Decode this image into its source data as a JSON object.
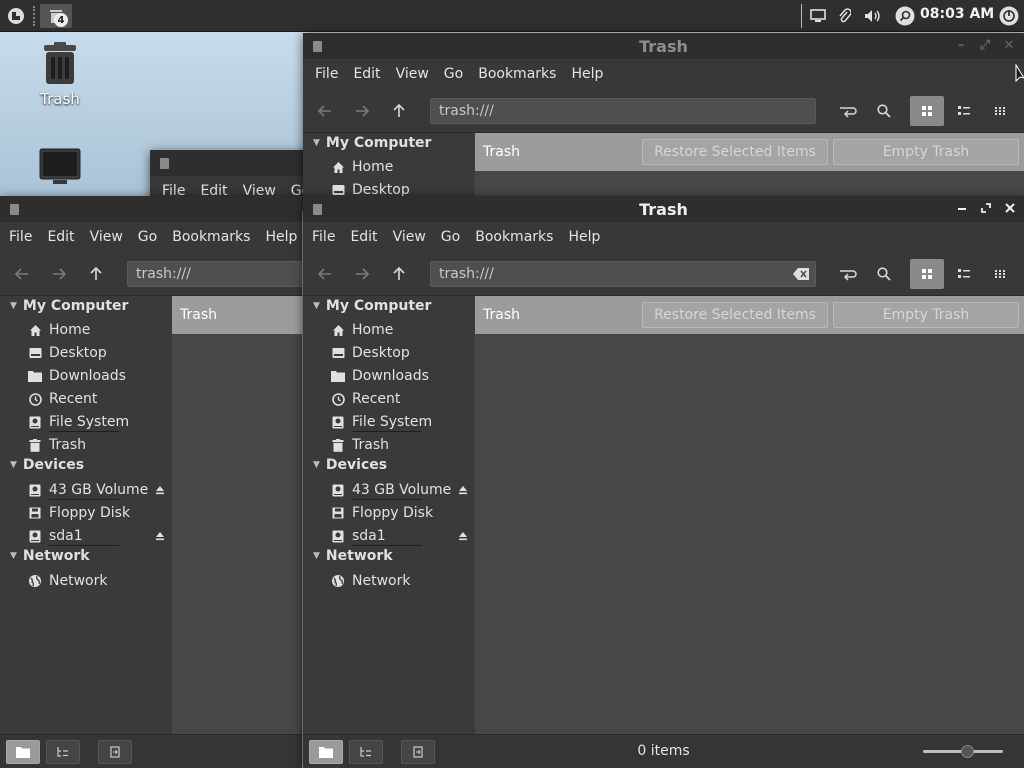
{
  "panel": {
    "workspace_badge": "4",
    "clock": "08:03 AM",
    "tray_icons": [
      "display-icon",
      "paperclip-icon",
      "volume-icon",
      "search-icon",
      "power-icon"
    ]
  },
  "desktop": {
    "icons": [
      {
        "label": "Trash",
        "icon": "trash-icon"
      },
      {
        "label": "",
        "icon": "monitor-icon"
      }
    ]
  },
  "menu": [
    "File",
    "Edit",
    "View",
    "Go",
    "Bookmarks",
    "Help"
  ],
  "back_window_top": {
    "title": "Trash"
  },
  "main_window": {
    "title": "Trash",
    "location": "trash:///",
    "path_label": "Trash",
    "restore_label": "Restore Selected Items",
    "empty_label": "Empty Trash",
    "status": "0 items"
  },
  "left_window": {
    "location": "trash:///",
    "path_label": "Trash"
  },
  "sidebar": {
    "sections": [
      {
        "title": "My Computer",
        "items": [
          {
            "label": "Home",
            "icon": "home-icon"
          },
          {
            "label": "Desktop",
            "icon": "desktop-icon"
          },
          {
            "label": "Downloads",
            "icon": "folder-icon"
          },
          {
            "label": "Recent",
            "icon": "clock-icon"
          },
          {
            "label": "File System",
            "icon": "drive-icon"
          },
          {
            "label": "Trash",
            "icon": "trash-icon"
          }
        ]
      },
      {
        "title": "Devices",
        "items": [
          {
            "label": "43 GB Volume",
            "icon": "drive-icon"
          },
          {
            "label": "Floppy Disk",
            "icon": "floppy-icon"
          },
          {
            "label": "sda1",
            "icon": "drive-icon"
          }
        ]
      },
      {
        "title": "Network",
        "items": [
          {
            "label": "Network",
            "icon": "globe-icon"
          }
        ]
      }
    ]
  },
  "colors": {
    "accent": "#9c9c9c",
    "window_bg": "#3d3d3d",
    "panel": "#2f2f2f"
  }
}
